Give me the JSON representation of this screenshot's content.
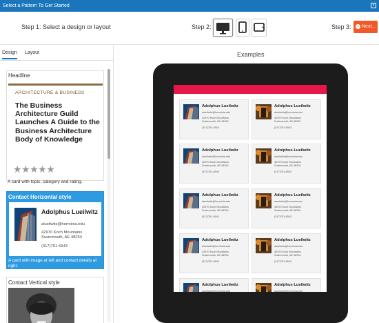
{
  "dialog": {
    "title": "Select a Pattern To Get Started",
    "close_glyph": "×"
  },
  "steps": {
    "step1": "Step 1: Select a design or layout",
    "step2": "Step 2:",
    "devices": [
      "desktop-icon",
      "tablet-icon",
      "tablet-landscape-icon"
    ],
    "selected_device": "desktop",
    "step3": "Step 3:",
    "next_label": "Next..."
  },
  "tabs": [
    {
      "label": "Design",
      "active": true
    },
    {
      "label": "Layout",
      "active": false
    }
  ],
  "designs": [
    {
      "header": "Headline",
      "category": "ARCHITECTURE & BUSINESS",
      "title": "The Business Architecture Guild Launches A Guide to the Business Architecture Body of Knowledge",
      "stars": "★★★★★",
      "caption": "A card with topic, category and rating."
    },
    {
      "header": "Contact Horizontal style",
      "name": "Adolphus Lueilwitz",
      "email": "alueilwitz@herminia.edu",
      "address1": "42970 Koch Mountains",
      "address2": "Susiemouth, AE  48254",
      "phone": "(317)751-6543",
      "caption": "A card with image at left and contact details at right.",
      "selected": true
    },
    {
      "header": "Contact Vertical style"
    }
  ],
  "preview": {
    "title": "Examples",
    "accent_color": "#e8174a",
    "card": {
      "name": "Adolphus Lueilwitz",
      "email": "alueilwitz@herminia.edu",
      "address1": "42970 Koch Mountains",
      "address2": "Susiemouth, AE  48254",
      "phone": "(317)751-6543"
    }
  },
  "colors": {
    "titlebar": "#1a75bb",
    "selected_card": "#2e9be0",
    "next_button": "#f05a28"
  }
}
